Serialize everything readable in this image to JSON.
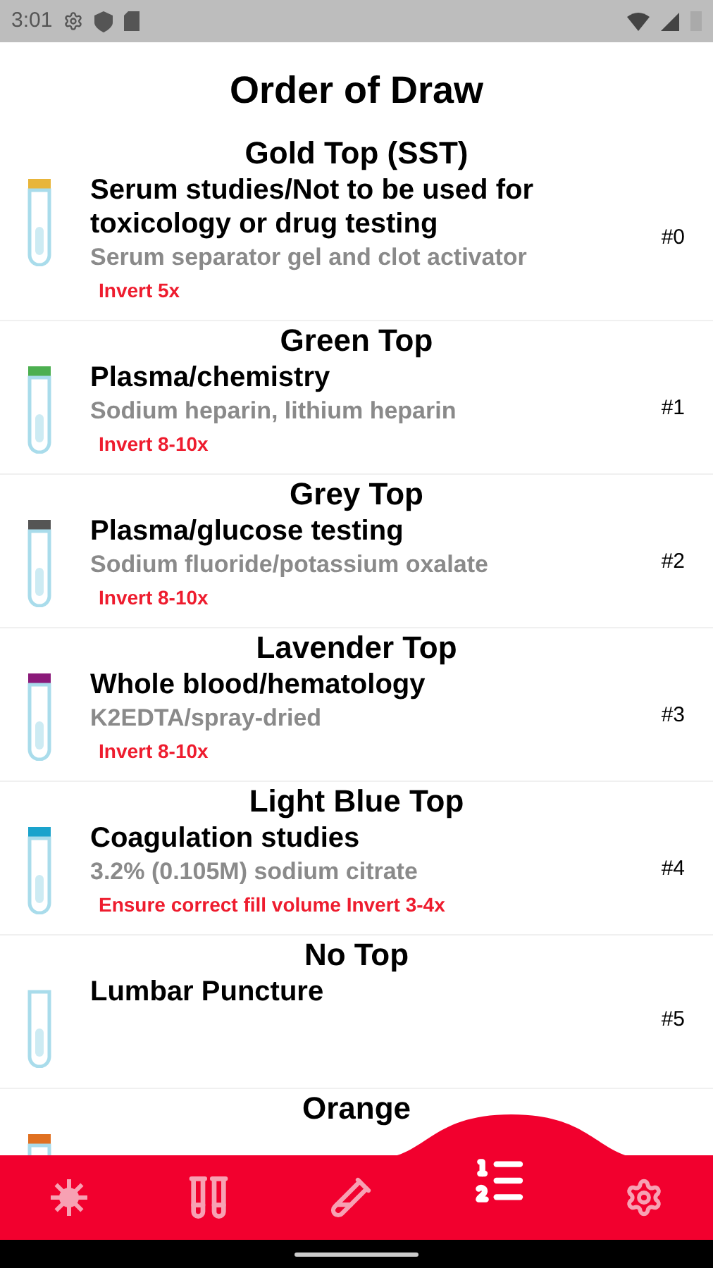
{
  "status_bar": {
    "time": "3:01"
  },
  "title": "Order of Draw",
  "tubes": [
    {
      "title": "Gold Top (SST)",
      "color": "#e8b53a",
      "use": "Serum studies/Not to be used for toxicology or drug testing",
      "additive": "Serum separator gel and clot activator",
      "note": "Invert 5x",
      "number": "#0"
    },
    {
      "title": "Green Top",
      "color": "#4caf50",
      "use": "Plasma/chemistry",
      "additive": "Sodium heparin, lithium heparin",
      "note": "Invert 8-10x",
      "number": "#1"
    },
    {
      "title": "Grey Top",
      "color": "#555555",
      "use": "Plasma/glucose testing",
      "additive": "Sodium fluoride/potassium oxalate",
      "note": "Invert 8-10x",
      "number": "#2"
    },
    {
      "title": "Lavender Top",
      "color": "#8b1a7a",
      "use": "Whole blood/hematology",
      "additive": "K2EDTA/spray-dried",
      "note": "Invert 8-10x",
      "number": "#3"
    },
    {
      "title": "Light Blue Top",
      "color": "#1aa3cc",
      "use": "Coagulation studies",
      "additive": "3.2% (0.105M) sodium citrate",
      "note": "Ensure correct fill volume Invert 3-4x",
      "number": "#4"
    },
    {
      "title": "No Top",
      "use": "Lumbar Puncture",
      "number": "#5"
    },
    {
      "title": "Orange",
      "color": "#e07020"
    }
  ],
  "nav": [
    {
      "kind": "virus",
      "selected": false
    },
    {
      "kind": "tubes",
      "selected": false
    },
    {
      "kind": "tube",
      "selected": false
    },
    {
      "kind": "list",
      "selected": true
    },
    {
      "kind": "settings",
      "selected": false
    }
  ]
}
